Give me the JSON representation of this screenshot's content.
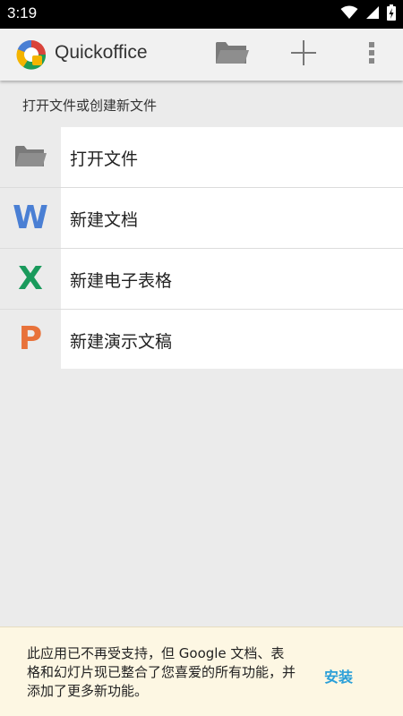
{
  "status_bar": {
    "time": "3:19",
    "icons": [
      "wifi-icon",
      "signal-icon",
      "battery-icon"
    ]
  },
  "app_bar": {
    "title": "Quickoffice",
    "actions": [
      "folder-icon",
      "add-icon",
      "overflow-menu-icon"
    ]
  },
  "section": {
    "header": "打开文件或创建新文件"
  },
  "list": {
    "items": [
      {
        "label": "打开文件",
        "icon": "folder-icon"
      },
      {
        "label": "新建文档",
        "icon": "word-doc-icon",
        "letter": "W",
        "color": "#4a7fd4"
      },
      {
        "label": "新建电子表格",
        "icon": "spreadsheet-icon",
        "letter": "X",
        "color": "#1a9a5c"
      },
      {
        "label": "新建演示文稿",
        "icon": "presentation-icon",
        "letter": "P",
        "color": "#e8723a"
      }
    ]
  },
  "banner": {
    "text": "此应用已不再受支持，但 Google 文档、表格和幻灯片现已整合了您喜爱的所有功能，并添加了更多新功能。",
    "action_label": "安装",
    "action_color": "#2a9fd8"
  }
}
